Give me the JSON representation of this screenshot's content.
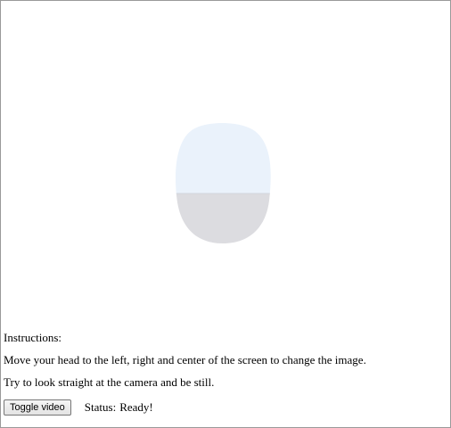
{
  "instructions": {
    "heading": "Instructions:",
    "line1": "Move your head to the left, right and center of the screen to change the image.",
    "line2": "Try to look straight at the camera and be still."
  },
  "controls": {
    "toggle_label": "Toggle video",
    "status_label": "Status:",
    "status_value": "Ready!"
  },
  "colors": {
    "face_top": "#eaf2fb",
    "face_bottom": "#dcdce0"
  }
}
